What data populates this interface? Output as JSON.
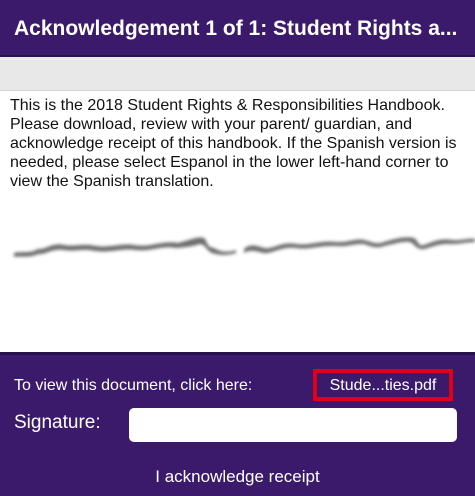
{
  "header": {
    "title": "Acknowledgement 1 of 1: Student Rights a..."
  },
  "content": {
    "body_text": "This is the 2018 Student Rights & Responsibilities Handbook.  Please download, review with your parent/ guardian, and acknowledge receipt of this handbook.  If the Spanish version is needed, please select Espanol in the lower left-hand corner to view the Spanish translation."
  },
  "footer": {
    "view_label": "To view this document, click here:",
    "document_link": "Stude...ties.pdf",
    "signature_label": "Signature:",
    "signature_value": "",
    "acknowledge_button": "I acknowledge receipt"
  },
  "colors": {
    "brand_purple": "#3b1a6b",
    "highlight_red": "#e00018"
  }
}
